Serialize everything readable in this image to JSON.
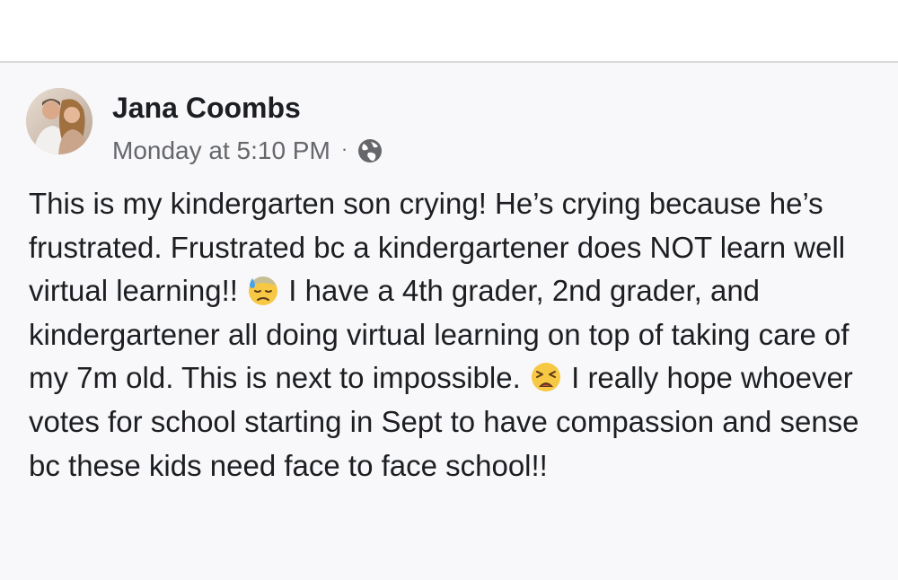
{
  "post": {
    "author_name": "Jana Coombs",
    "timestamp": "Monday at 5:10 PM",
    "separator": "·",
    "privacy_icon": "globe-icon",
    "text_part1": "This is my kindergarten son crying! He’s crying because he’s frustrated. Frustrated bc a kindergartener does NOT learn well virtual learning!! ",
    "emoji1": "sweat-frowning-face-emoji",
    "text_part2": " I have a 4th grader, 2nd grader, and kindergartener all doing virtual learning on top of taking care of my 7m old. This is next to impossible. ",
    "emoji2": "weary-face-emoji",
    "text_part3": " I really hope whoever votes for school starting in Sept to have compassion and sense bc these kids need face to face school!!"
  },
  "colors": {
    "background": "#f8f8fa",
    "text": "#1c1e21",
    "meta_text": "#65676b",
    "divider": "#d9dadc"
  }
}
